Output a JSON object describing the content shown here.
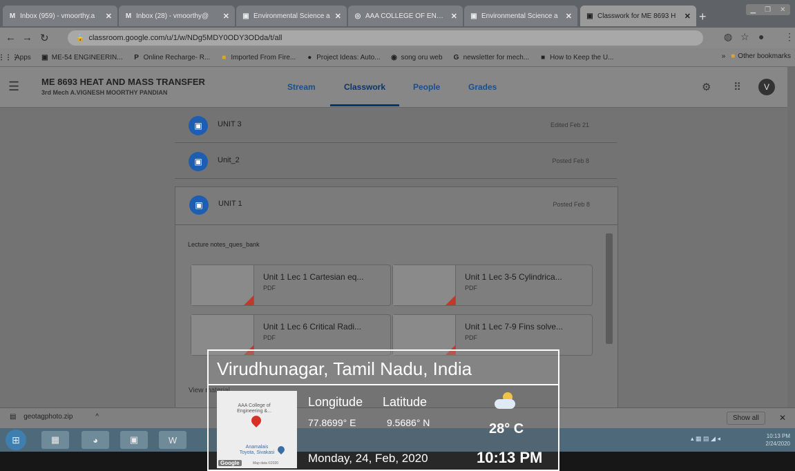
{
  "tabs": [
    {
      "label": "Inbox (959) - vmoorthy.a",
      "icon": "M"
    },
    {
      "label": "Inbox (28) - vmoorthy@",
      "icon": "M"
    },
    {
      "label": "Environmental Science a",
      "icon": "▣"
    },
    {
      "label": "AAA COLLEGE OF ENGIN",
      "icon": "◎"
    },
    {
      "label": "Environmental Science a",
      "icon": "▣"
    },
    {
      "label": "Classwork for ME 8693 H",
      "icon": "▣"
    }
  ],
  "address": {
    "url": "classroom.google.com/u/1/w/NDg5MDY0ODY3ODda/t/all"
  },
  "bookmarks": [
    {
      "label": "Apps",
      "icon": "⋮⋮⋮"
    },
    {
      "label": "ME-54 ENGINEERIN...",
      "icon": "▣"
    },
    {
      "label": "Online Recharge- R...",
      "icon": "P"
    },
    {
      "label": "Imported From Fire...",
      "icon": "■"
    },
    {
      "label": "Project Ideas: Auto...",
      "icon": "●"
    },
    {
      "label": "song oru web",
      "icon": "◉"
    },
    {
      "label": "newsletter for mech...",
      "icon": "G"
    },
    {
      "label": "How to Keep the U...",
      "icon": "■"
    }
  ],
  "bookmarks_other": "Other bookmarks",
  "classroom": {
    "title": "ME 8693 HEAT AND MASS TRANSFER",
    "subtitle": "3rd Mech A.VIGNESH MOORTHY PANDIAN",
    "nav": [
      "Stream",
      "Classwork",
      "People",
      "Grades"
    ],
    "avatar": "V"
  },
  "units": [
    {
      "name": "UNIT 3",
      "date": "Edited Feb 21"
    },
    {
      "name": "Unit_2",
      "date": "Posted Feb 8"
    },
    {
      "name": "UNIT 1",
      "date": "Posted Feb 8"
    }
  ],
  "material": {
    "section": "Lecture notes_ques_bank",
    "cards": [
      {
        "title": "Unit 1 Lec 1 Cartesian eq...",
        "type": "PDF"
      },
      {
        "title": "Unit 1 Lec 3-5 Cylindrica...",
        "type": "PDF"
      },
      {
        "title": "Unit 1 Lec 6 Critical Radi...",
        "type": "PDF"
      },
      {
        "title": "Unit 1 Lec 7-9 Fins solve...",
        "type": "PDF"
      }
    ],
    "view_label": "View material"
  },
  "download": {
    "file": "geotagphoto.zip",
    "show_all": "Show all"
  },
  "clock": {
    "time": "10:13 PM",
    "date": "2/24/2020"
  },
  "geotag": {
    "place": "Virudhunagar, Tamil Nadu, India",
    "lon_label": "Longitude",
    "lat_label": "Latitude",
    "lon": "77.8699° E",
    "lat": "9.5686° N",
    "temp": "28° C",
    "date": "Monday, 24, Feb, 2020",
    "time": "10:13 PM",
    "map_label1": "AAA College of Engineering &...",
    "map_label2": "Anamalais Toyota, Sivakasi",
    "map_google": "Google",
    "map_data": "Map data ©2020"
  }
}
